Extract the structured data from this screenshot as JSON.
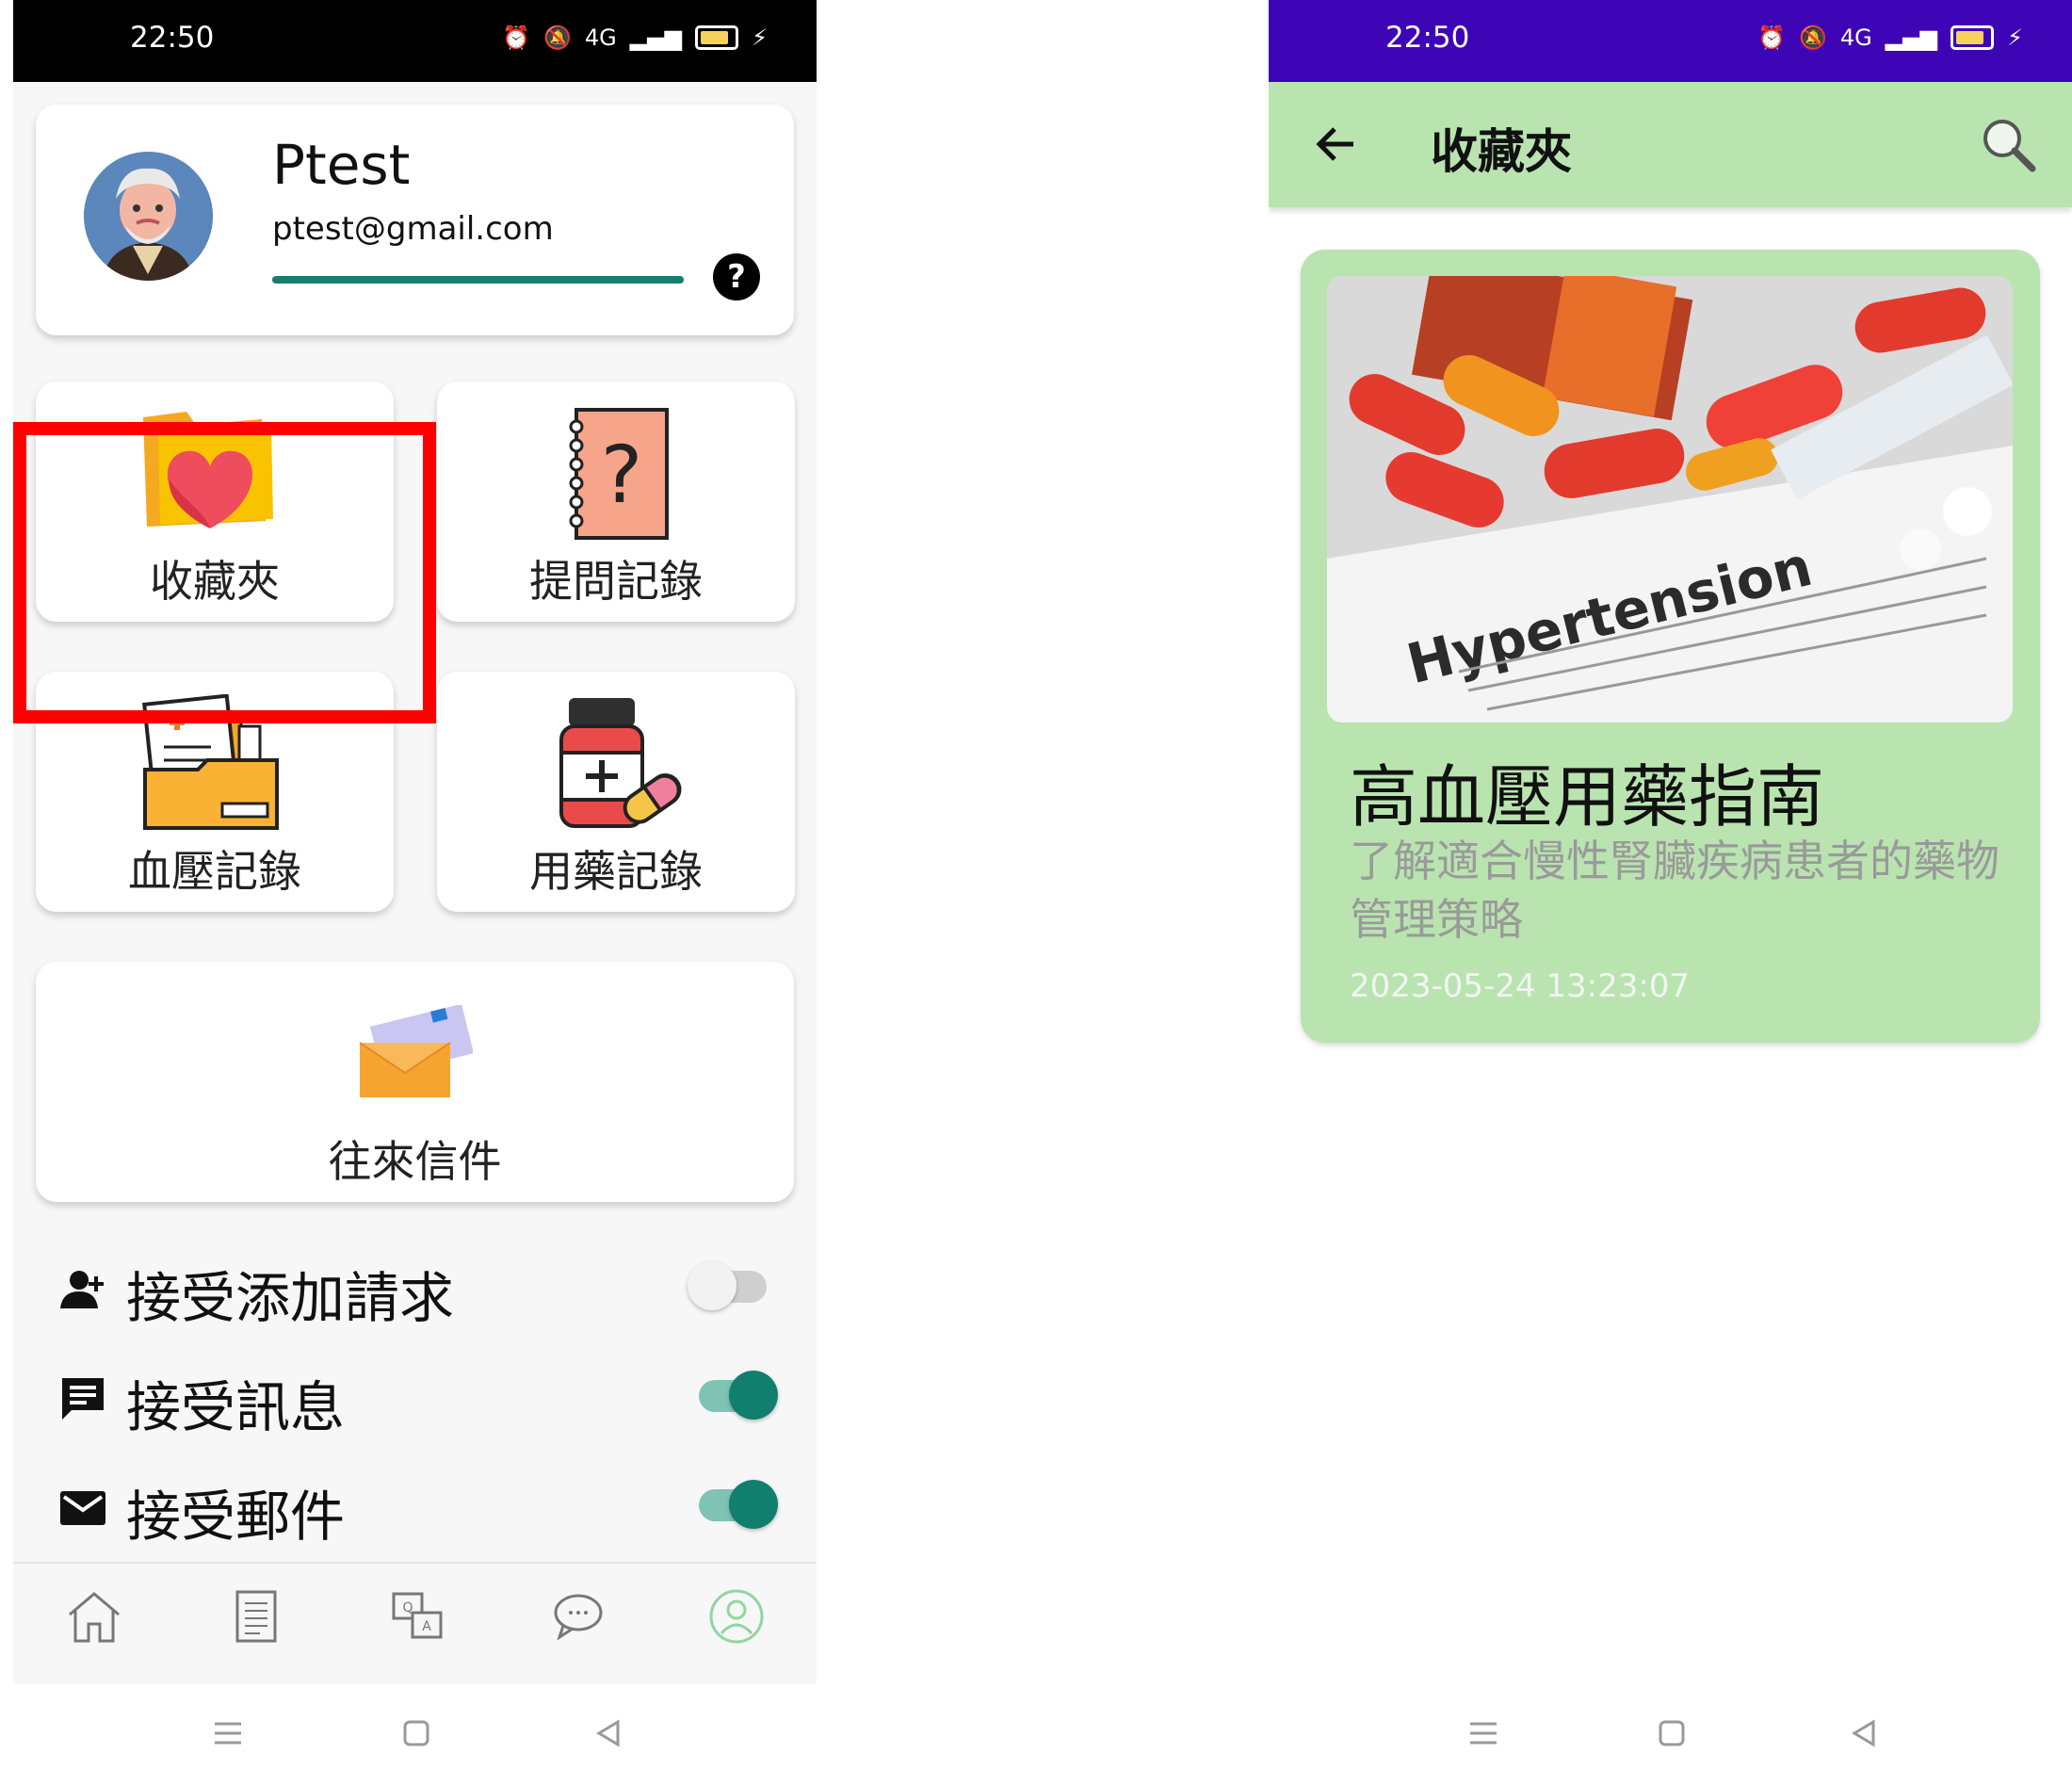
{
  "left_screen": {
    "status": {
      "time": "22:50",
      "network": "4G"
    },
    "profile": {
      "name": "Ptest",
      "email": "ptest@gmail.com",
      "progress_fraction": 1.0,
      "help_glyph": "?"
    },
    "tiles": {
      "favorites": "收藏夾",
      "questions": "提問記錄",
      "blood_pressure": "血壓記錄",
      "medication": "用藥記錄",
      "mail": "往來信件"
    },
    "settings": [
      {
        "label": "接受添加請求",
        "icon": "person-add-icon",
        "enabled": false
      },
      {
        "label": "接受訊息",
        "icon": "message-icon",
        "enabled": true
      },
      {
        "label": "接受郵件",
        "icon": "mail-icon",
        "enabled": true
      }
    ],
    "bottom_nav": [
      "home-icon",
      "document-icon",
      "qa-icon",
      "chat-icon",
      "profile-icon"
    ],
    "active_nav": "profile-icon",
    "highlight_color": "#ff0000"
  },
  "right_screen": {
    "status": {
      "time": "22:50",
      "network": "4G"
    },
    "appbar": {
      "title": "收藏夾",
      "accent": "#b9e4b0"
    },
    "article": {
      "image_text": "Hypertension",
      "title": "高血壓用藥指南",
      "subtitle": "了解適合慢性腎臟疾病患者的藥物管理策略",
      "date": "2023-05-24 13:23:07"
    }
  },
  "colors": {
    "left_statusbar": "#000000",
    "right_statusbar": "#3d05b6",
    "toggle_on": "#117f6d",
    "card_green": "#b9e4b0"
  }
}
